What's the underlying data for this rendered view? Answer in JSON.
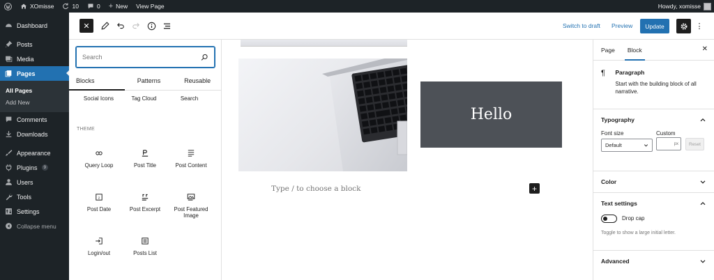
{
  "admin_bar": {
    "site_name": "XOmisse",
    "updates_count": "10",
    "comments_count": "0",
    "new_label": "New",
    "view_page_label": "View Page",
    "howdy": "Howdy, xomisse"
  },
  "admin_menu": {
    "items": [
      {
        "label": "Dashboard",
        "icon": "dashboard-icon"
      },
      {
        "label": "Posts",
        "icon": "pin-icon"
      },
      {
        "label": "Media",
        "icon": "media-icon"
      },
      {
        "label": "Pages",
        "icon": "pages-icon"
      },
      {
        "label": "Comments",
        "icon": "comment-icon"
      },
      {
        "label": "Downloads",
        "icon": "download-icon"
      },
      {
        "label": "Appearance",
        "icon": "brush-icon"
      },
      {
        "label": "Plugins",
        "icon": "plugin-icon",
        "badge": "9"
      },
      {
        "label": "Users",
        "icon": "users-icon"
      },
      {
        "label": "Tools",
        "icon": "wrench-icon"
      },
      {
        "label": "Settings",
        "icon": "sliders-icon"
      },
      {
        "label": "Collapse menu",
        "icon": "collapse-icon"
      }
    ],
    "pages_submenu": [
      "All Pages",
      "Add New"
    ],
    "current": "Pages"
  },
  "editor_header": {
    "switch_to_draft": "Switch to draft",
    "preview": "Preview",
    "update": "Update"
  },
  "inserter": {
    "search_placeholder": "Search",
    "tabs": [
      "Blocks",
      "Patterns",
      "Reusable"
    ],
    "active_tab": "Blocks",
    "top_row": [
      "Social Icons",
      "Tag Cloud",
      "Search"
    ],
    "section_label": "THEME",
    "blocks": [
      {
        "label": "Query Loop",
        "icon": "loop-icon"
      },
      {
        "label": "Post Title",
        "icon": "post-title-icon"
      },
      {
        "label": "Post Content",
        "icon": "post-content-icon"
      },
      {
        "label": "Post Date",
        "icon": "calendar-icon"
      },
      {
        "label": "Post Excerpt",
        "icon": "excerpt-icon"
      },
      {
        "label": "Post Featured Image",
        "icon": "featured-image-icon"
      },
      {
        "label": "Login/out",
        "icon": "login-icon"
      },
      {
        "label": "Posts List",
        "icon": "list-icon"
      }
    ]
  },
  "canvas": {
    "hello_text": "Hello",
    "placeholder": "Type / to choose a block"
  },
  "sidebar": {
    "tabs": [
      "Page",
      "Block"
    ],
    "active_tab": "Block",
    "block_title": "Paragraph",
    "block_desc": "Start with the building block of all narrative.",
    "typography": {
      "title": "Typography",
      "font_size_label": "Font size",
      "custom_label": "Custom",
      "font_size_value": "Default",
      "unit": "px",
      "reset": "Reset"
    },
    "color_title": "Color",
    "text_settings": {
      "title": "Text settings",
      "drop_cap": "Drop cap",
      "help": "Toggle to show a large initial letter."
    },
    "advanced_title": "Advanced"
  },
  "colors": {
    "admin_bg": "#1d2327",
    "accent": "#2271b1",
    "hello_bg": "#4d5157"
  }
}
